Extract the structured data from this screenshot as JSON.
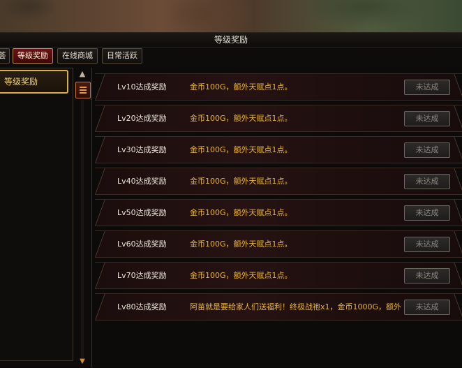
{
  "window": {
    "title": "等级奖励"
  },
  "tabs": [
    {
      "label": "荟"
    },
    {
      "label": "等级奖励",
      "active": true
    },
    {
      "label": "在线商城"
    },
    {
      "label": "日常活跃"
    }
  ],
  "sidebar": {
    "items": [
      {
        "label": "等级奖励"
      }
    ]
  },
  "rewards": [
    {
      "level": "Lv10达成奖励",
      "desc": "金币100G，额外天赋点1点。",
      "button": "未达成"
    },
    {
      "level": "Lv20达成奖励",
      "desc": "金币100G，额外天赋点1点。",
      "button": "未达成"
    },
    {
      "level": "Lv30达成奖励",
      "desc": "金币100G，额外天赋点1点。",
      "button": "未达成"
    },
    {
      "level": "Lv40达成奖励",
      "desc": "金币100G，额外天赋点1点。",
      "button": "未达成"
    },
    {
      "level": "Lv50达成奖励",
      "desc": "金币100G，额外天赋点1点。",
      "button": "未达成"
    },
    {
      "level": "Lv60达成奖励",
      "desc": "金币100G，额外天赋点1点。",
      "button": "未达成"
    },
    {
      "level": "Lv70达成奖励",
      "desc": "金币100G，额外天赋点1点。",
      "button": "未达成"
    },
    {
      "level": "Lv80达成奖励",
      "desc": "阿苗就是要给家人们送福利！终极战袍x1，金币1000G，额外",
      "button": "未达成"
    }
  ],
  "icons": {
    "scroll_up": "chevron-up-icon",
    "scroll_down": "chevron-down-icon",
    "scroll_thumb": "menu-icon"
  },
  "colors": {
    "accent_gold": "#e8b534",
    "tab_active": "#6a1313",
    "button_disabled_text": "#8d8880"
  }
}
